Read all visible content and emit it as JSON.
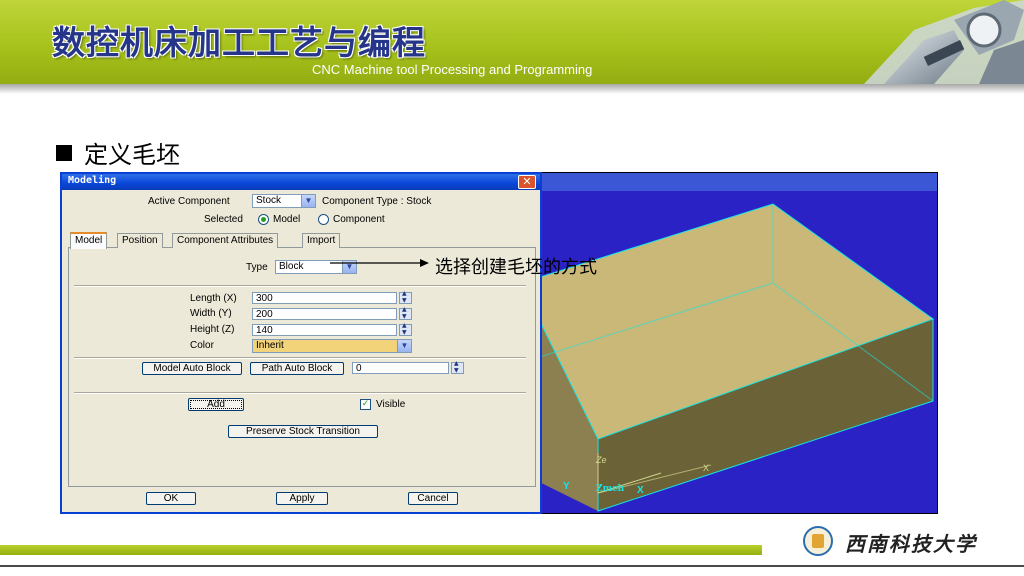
{
  "slide": {
    "title_cn": "数控机床加工工艺与编程",
    "title_en": "CNC Machine tool Processing and Programming",
    "bullet": "定义毛坯",
    "annotation": "选择创建毛坯的方式",
    "university": "西南科技大学"
  },
  "dialog": {
    "title": "Modeling",
    "close_glyph": "✕",
    "active_component_label": "Active Component",
    "active_component_value": "Stock",
    "component_type": "Component Type : Stock",
    "selected_label": "Selected",
    "radio_model": "Model",
    "radio_component": "Component",
    "tabs": [
      "Model",
      "Position",
      "Component Attributes",
      "Import"
    ],
    "type_label": "Type",
    "type_value": "Block",
    "length_label": "Length (X)",
    "length_value": "300",
    "width_label": "Width (Y)",
    "width_value": "200",
    "height_label": "Height (Z)",
    "height_value": "140",
    "color_label": "Color",
    "color_value": "Inherit",
    "model_auto_block": "Model Auto Block",
    "path_auto_block": "Path Auto Block",
    "auto_block_value": "0",
    "add": "Add",
    "visible": "Visible",
    "preserve": "Preserve Stock Transition",
    "ok": "OK",
    "apply": "Apply",
    "cancel": "Cancel"
  },
  "viewport": {
    "labels": [
      "Ze",
      "X",
      "Y",
      "Zmch",
      "X"
    ]
  },
  "colors": {
    "header_green": "#a7c21c",
    "title_blue": "#24358a",
    "viewport_bg": "#2a22c4",
    "stock_top": "#c9b877",
    "stock_edge": "#00e0e0",
    "color_field": "#f3d37a"
  }
}
